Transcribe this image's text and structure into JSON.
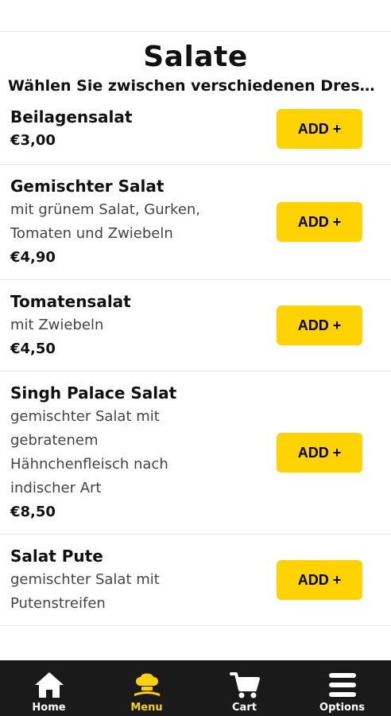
{
  "section": {
    "title": "Salate",
    "subtitle": "Wählen Sie zwischen verschiedenen Dressin..."
  },
  "items": [
    {
      "name": "Beilagensalat",
      "desc_lines": [],
      "price": "€3,00",
      "button": "ADD +"
    },
    {
      "name": "Gemischter Salat",
      "desc_lines": [
        "mit grünem Salat, Gurken,",
        "Tomaten und Zwiebeln"
      ],
      "price": "€4,90",
      "button": "ADD +"
    },
    {
      "name": "Tomatensalat",
      "desc_lines": [
        "mit Zwiebeln"
      ],
      "price": "€4,50",
      "button": "ADD +"
    },
    {
      "name": "Singh Palace Salat",
      "desc_lines": [
        "gemischter Salat mit",
        "gebratenem",
        "Hähnchenfleisch nach",
        "indischer Art"
      ],
      "price": "€8,50",
      "button": "ADD +"
    },
    {
      "name": "Salat Pute",
      "desc_lines": [
        "gemischter Salat mit",
        "Putenstreifen"
      ],
      "price": "",
      "button": "ADD +"
    }
  ],
  "nav": {
    "home": "Home",
    "menu": "Menu",
    "cart": "Cart",
    "options": "Options"
  },
  "colors": {
    "accent": "#ffd200",
    "nav_bg": "#1a1a1a"
  },
  "icons": {
    "home": "home-icon",
    "menu": "chef-hat-icon",
    "cart": "cart-icon",
    "options": "hamburger-menu-icon"
  }
}
